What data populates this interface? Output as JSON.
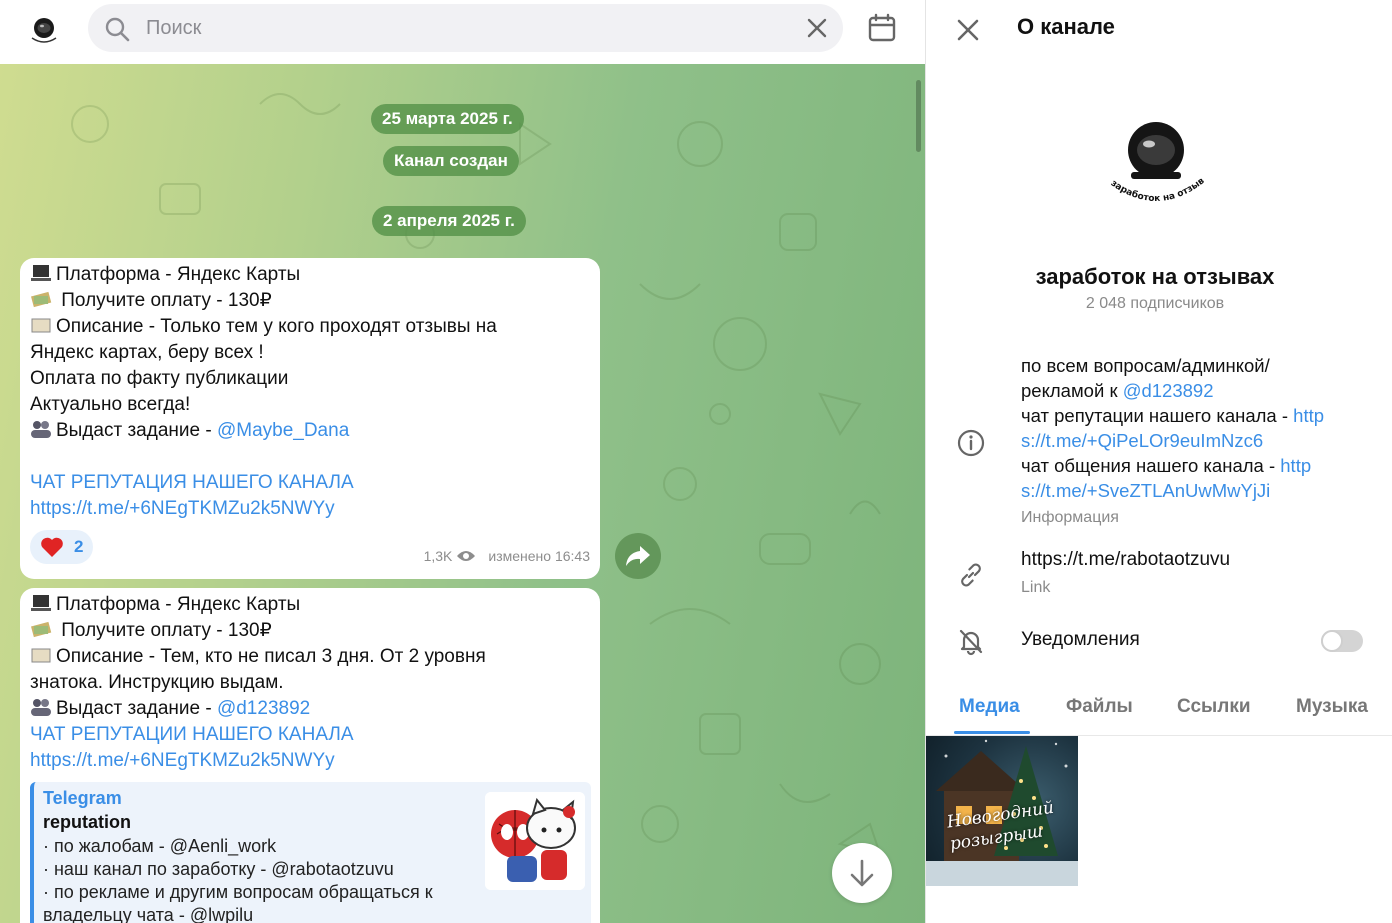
{
  "search": {
    "placeholder": "Поиск"
  },
  "chat": {
    "dates": {
      "first": "25 марта 2025 г.",
      "service": "Канал создан",
      "second": "2 апреля 2025 г."
    },
    "message1": {
      "lines": [
        "Платформа - Яндекс Карты",
        " Получите оплату - 130₽",
        "Описание - Только тем у кого проходят отзывы на",
        "Яндекс картах, беру всех !",
        "Оплата по факту публикации",
        "Актуально всегда!",
        "Выдаст задание - "
      ],
      "mention": "@Maybe_Dana",
      "chat_link_title": "ЧАТ РЕПУТАЦИЯ НАШЕГО КАНАЛА",
      "chat_link_url": "https://t.me/+6NEgTKMZu2k5NWYy",
      "reaction_count": "2",
      "views": "1,3K",
      "edited": "изменено 16:43"
    },
    "message2": {
      "lines": [
        "Платформа - Яндекс Карты",
        " Получите оплату - 130₽",
        "Описание -  Тем, кто не писал 3 дня. От 2 уровня",
        "знатока. Инструкцию выдам.",
        "Выдаст задание - "
      ],
      "mention": "@d123892",
      "chat_link_title": "ЧАТ РЕПУТАЦИИ НАШЕГО КАНАЛА",
      "chat_link_url": "https://t.me/+6NEgTKMZu2k5NWYy",
      "preview": {
        "site": "Telegram",
        "title": "reputation",
        "lines": [
          "· по жалобам - @Aenli_work",
          "· наш канал по заработку - @rabotaotzuvu",
          "· по рекламе и другим вопросам обращаться к",
          "владельцу чата - @lwpilu"
        ]
      }
    }
  },
  "panel": {
    "title": "О канале",
    "channel_name": "заработок на отзывах",
    "subscribers": "2 048 подписчиков",
    "logo_text": "заработок на отзывах",
    "info": {
      "l1": "по всем вопросам/админкой/",
      "l2_pre": "рекламой к ",
      "l2_link": "@d123892",
      "l3_pre": "чат репутации нашего канала - ",
      "l3_link": "http",
      "l4_link": "s://t.me/+QiPeLOr9euImNzc6",
      "l5_pre": "чат общения нашего канала - ",
      "l5_link": "http",
      "l6_link": "s://t.me/+SveZTLAnUwMwYjJi",
      "caption": "Информация"
    },
    "link": {
      "value": "https://t.me/rabotaotzuvu",
      "caption": "Link"
    },
    "notifications": {
      "label": "Уведомления",
      "enabled": false
    },
    "tabs": [
      "Медиа",
      "Файлы",
      "Ссылки",
      "Музыка"
    ],
    "active_tab": "Медиа",
    "media": {
      "caption_l1": "Новогодний",
      "caption_l2": "розыгрыш"
    }
  },
  "colors": {
    "accent": "#3a8ee6",
    "pill": "#529046",
    "bubble": "#ffffff",
    "reaction_bg": "#e8f1fb"
  }
}
